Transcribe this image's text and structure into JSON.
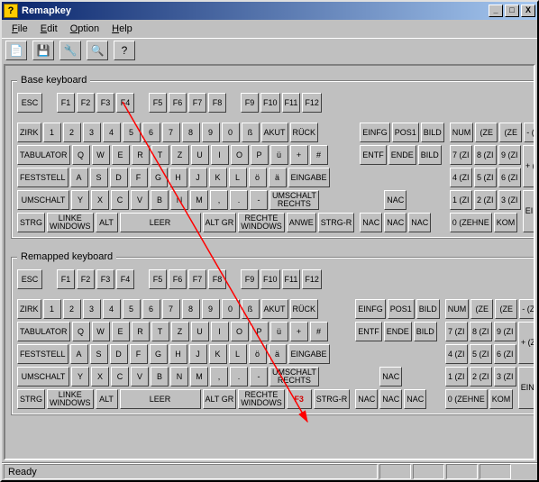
{
  "titlebar": {
    "title": "Remapkey",
    "icon_glyph": "?"
  },
  "menus": {
    "file": "File",
    "edit": "Edit",
    "option": "Option",
    "help": "Help"
  },
  "toolbar": {
    "b1": "📄",
    "b2": "💾",
    "b3": "🔧",
    "b4": "🔍",
    "b5": "?"
  },
  "fieldsets": {
    "base": "Base keyboard",
    "remap": "Remapped keyboard"
  },
  "status": {
    "text": "Ready"
  },
  "keys": {
    "esc": "ESC",
    "frow": [
      "F1",
      "F2",
      "F3",
      "F4",
      "F5",
      "F6",
      "F7",
      "F8",
      "F9",
      "F10",
      "F11",
      "F12"
    ],
    "r1": [
      "ZIRK",
      "1",
      "2",
      "3",
      "4",
      "5",
      "6",
      "7",
      "8",
      "9",
      "0",
      "ß",
      "AKUT",
      "RÜCK"
    ],
    "r2": [
      "TABULATOR",
      "Q",
      "W",
      "E",
      "R",
      "T",
      "Z",
      "U",
      "I",
      "O",
      "P",
      "ü",
      "+",
      "#"
    ],
    "r3": [
      "FESTSTELL",
      "A",
      "S",
      "D",
      "F",
      "G",
      "H",
      "J",
      "K",
      "L",
      "ö",
      "ä",
      "EINGABE"
    ],
    "r4": [
      "UMSCHALT",
      "Y",
      "X",
      "C",
      "V",
      "B",
      "N",
      "M",
      ",",
      ".",
      "-",
      "UMSCHALT\nRECHTS"
    ],
    "r5": [
      "STRG",
      "LINKE\nWINDOWS",
      "ALT",
      "LEER",
      "ALT GR",
      "RECHTE\nWINDOWS",
      "ANWE",
      "STRG-R"
    ],
    "r5_remap": [
      "STRG",
      "LINKE\nWINDOWS",
      "ALT",
      "LEER",
      "ALT GR",
      "RECHTE\nWINDOWS",
      "F3",
      "STRG-R"
    ],
    "nav1": [
      "EINFG",
      "POS1",
      "BILD"
    ],
    "nav2": [
      "ENTF",
      "ENDE",
      "BILD"
    ],
    "nav3": "NAC",
    "nav4": [
      "NAC",
      "NAC",
      "NAC"
    ],
    "np": {
      "r1": [
        "NUM",
        "(ZE",
        "(ZE",
        "- (ZE"
      ],
      "r2": [
        "7 (ZI",
        "8 (ZI",
        "9 (ZI"
      ],
      "plus": "+ (ZI",
      "r3": [
        "4 (ZI",
        "5 (ZI",
        "6 (ZI"
      ],
      "r4": [
        "1 (ZI",
        "2 (ZI",
        "3 (ZI"
      ],
      "enter": "EING",
      "r5": [
        "0 (ZEHNE",
        "KOM"
      ]
    }
  }
}
